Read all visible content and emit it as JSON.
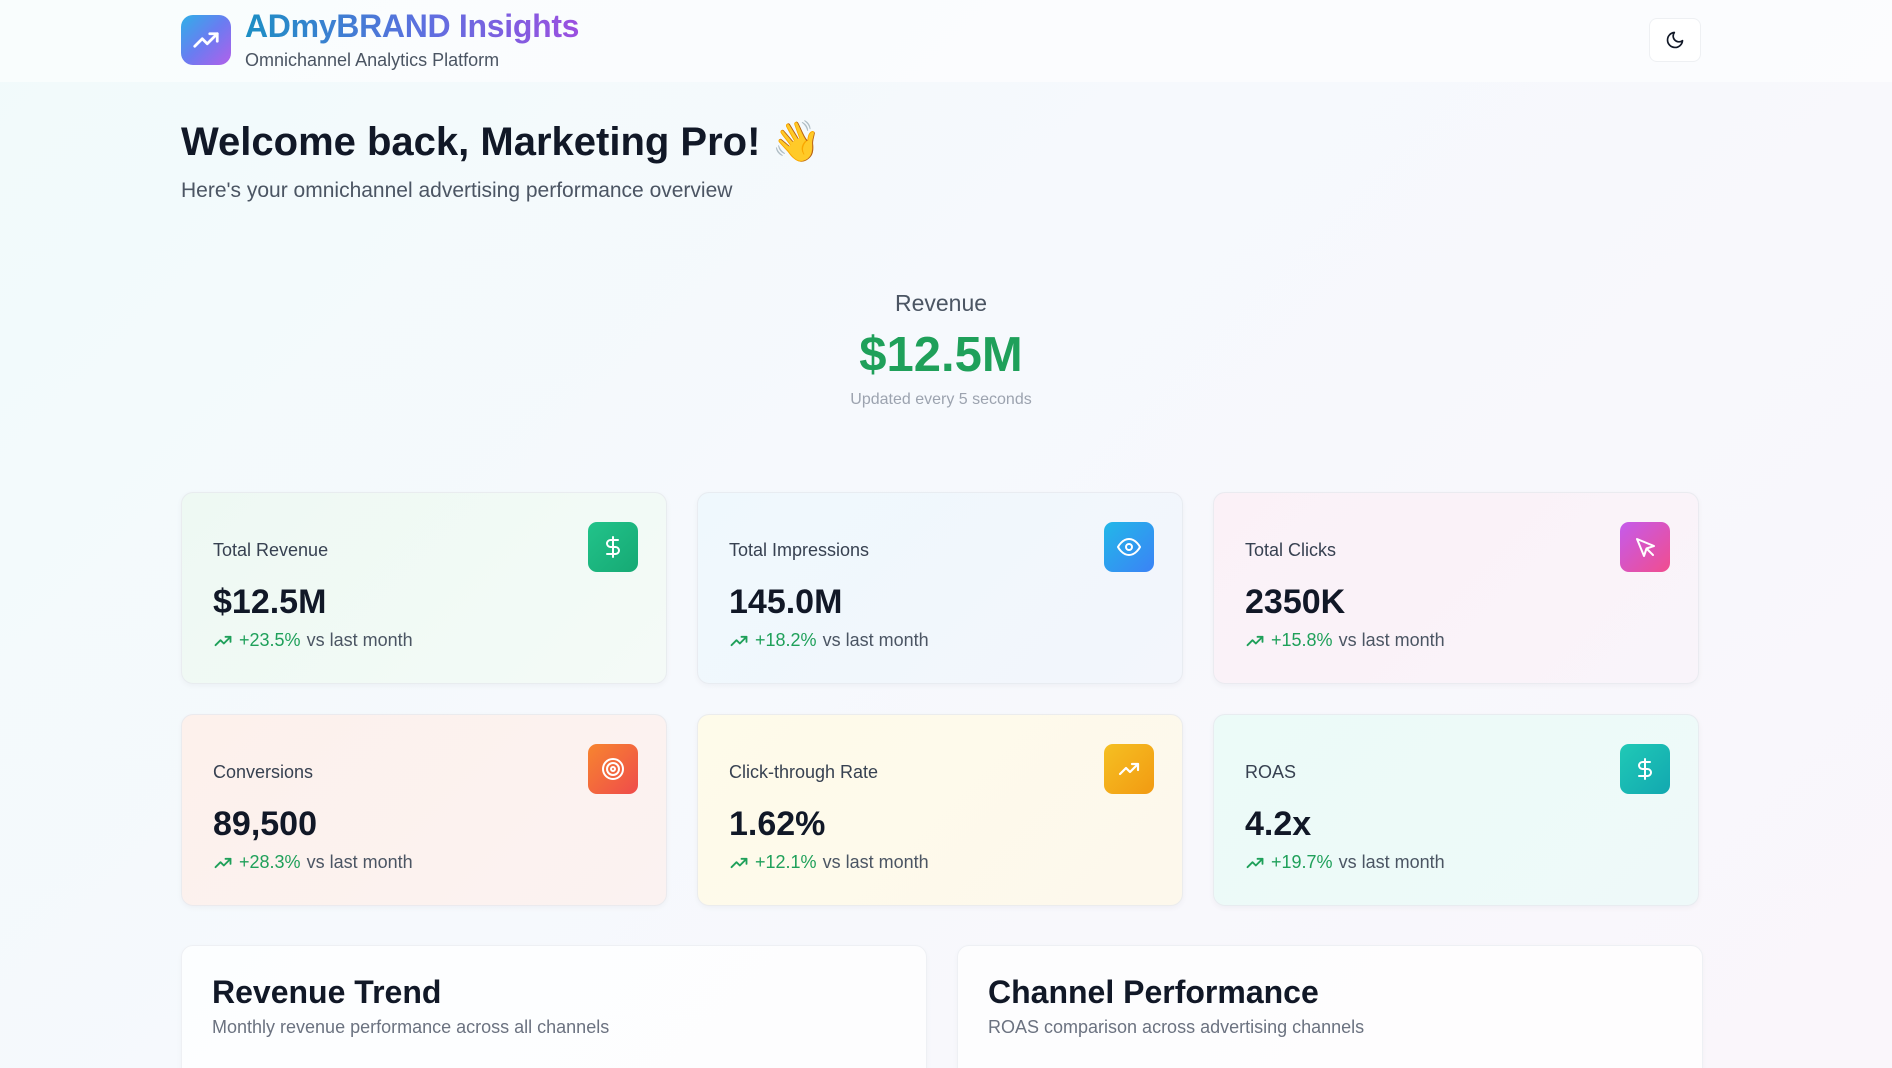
{
  "brand": {
    "title": "ADmyBRAND Insights",
    "subtitle": "Omnichannel Analytics Platform",
    "logo_icon": "trending-up-icon",
    "theme_toggle_icon": "moon-icon"
  },
  "welcome": {
    "title": "Welcome back, Marketing Pro! 👋",
    "subtitle": "Here's your omnichannel advertising performance overview"
  },
  "live_metric": {
    "label": "Revenue",
    "value": "$12.5M",
    "note": "Updated every 5 seconds"
  },
  "cards": [
    {
      "label": "Total Revenue",
      "value": "$12.5M",
      "change": "+23.5%",
      "vs": "vs last month",
      "icon": "dollar-icon"
    },
    {
      "label": "Total Impressions",
      "value": "145.0M",
      "change": "+18.2%",
      "vs": "vs last month",
      "icon": "eye-icon"
    },
    {
      "label": "Total Clicks",
      "value": "2350K",
      "change": "+15.8%",
      "vs": "vs last month",
      "icon": "cursor-icon"
    },
    {
      "label": "Conversions",
      "value": "89,500",
      "change": "+28.3%",
      "vs": "vs last month",
      "icon": "target-icon"
    },
    {
      "label": "Click-through Rate",
      "value": "1.62%",
      "change": "+12.1%",
      "vs": "vs last month",
      "icon": "trending-up-icon"
    },
    {
      "label": "ROAS",
      "value": "4.2x",
      "change": "+19.7%",
      "vs": "vs last month",
      "icon": "dollar-icon"
    }
  ],
  "panels": [
    {
      "title": "Revenue Trend",
      "subtitle": "Monthly revenue performance across all channels"
    },
    {
      "title": "Channel Performance",
      "subtitle": "ROAS comparison across advertising channels"
    }
  ],
  "colors": {
    "positive": "#1fa05a",
    "accent_blue": "#1c8fc4",
    "accent_purple": "#9b4fe0"
  }
}
